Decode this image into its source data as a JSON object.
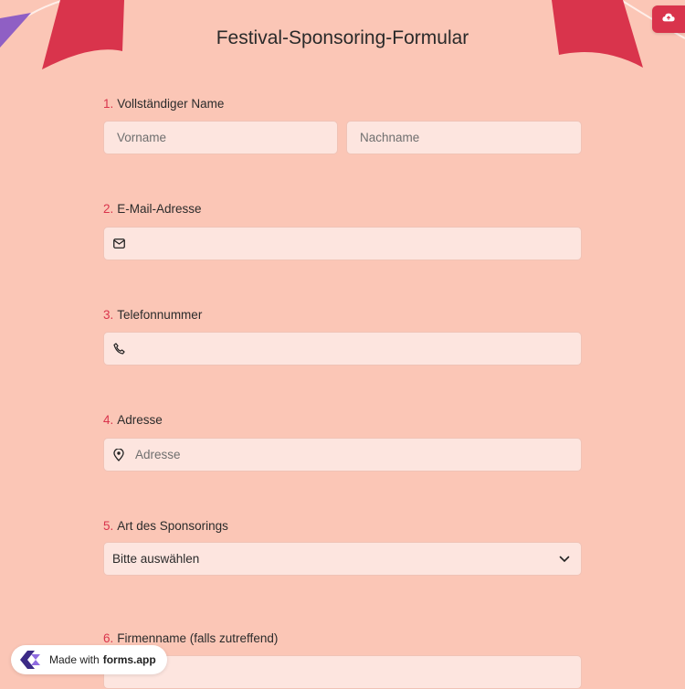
{
  "form": {
    "title": "Festival-Sponsoring-Formular",
    "questions": [
      {
        "number": "1.",
        "label": "Vollständiger Name",
        "first_placeholder": "Vorname",
        "last_placeholder": "Nachname"
      },
      {
        "number": "2.",
        "label": "E-Mail-Adresse",
        "icon": "mail-icon"
      },
      {
        "number": "3.",
        "label": "Telefonnummer",
        "icon": "phone-icon"
      },
      {
        "number": "4.",
        "label": "Adresse",
        "icon": "location-pin-icon",
        "placeholder": "Adresse"
      },
      {
        "number": "5.",
        "label": "Art des Sponsorings",
        "selected": "Bitte auswählen"
      },
      {
        "number": "6.",
        "label": "Firmenname (falls zutreffend)"
      }
    ]
  },
  "badge": {
    "prefix": "Made with",
    "brand": "forms.app"
  },
  "colors": {
    "background": "#fbc6b6",
    "accent": "#d9344c",
    "field": "#fde5df",
    "flag_purple": "#8f5fc4"
  },
  "icons": {
    "save": "cloud-upload-icon",
    "select": "chevron-down-icon",
    "logo": "forms-app-logo"
  }
}
